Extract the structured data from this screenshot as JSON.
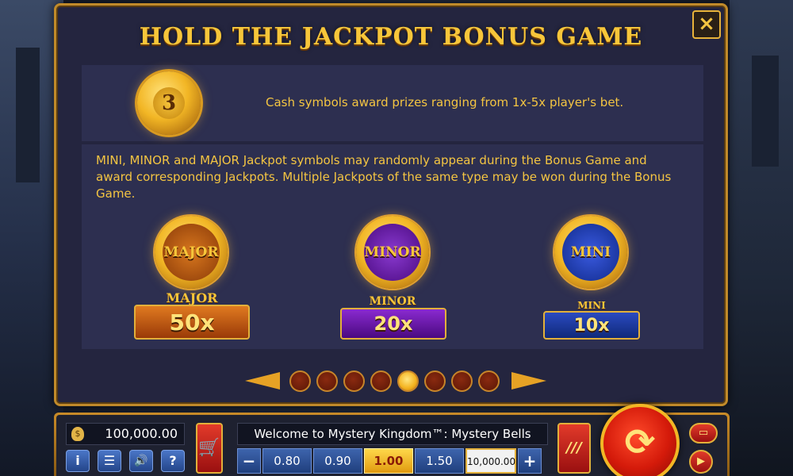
{
  "panel": {
    "title": "HOLD THE JACKPOT BONUS GAME",
    "close_icon": "×",
    "cash_coin_label": "3",
    "cash_text": "Cash symbols award prizes ranging from 1x-5x player's bet.",
    "jackpot_text": "MINI, MINOR and MAJOR Jackpot symbols may randomly appear during the Bonus Game and award corresponding Jackpots. Multiple Jackpots of the same type may be won during the Bonus Game.",
    "jackpots": [
      {
        "medal_label": "MAJOR",
        "name": "MAJOR",
        "multiplier": "50x",
        "color": "#c45a12"
      },
      {
        "medal_label": "MINOR",
        "name": "MINOR",
        "multiplier": "20x",
        "color": "#6a1fa0"
      },
      {
        "medal_label": "MINI",
        "name": "MINI",
        "multiplier": "10x",
        "color": "#1f3a9a"
      }
    ],
    "pagination": {
      "total": 8,
      "active_index": 4
    }
  },
  "bottom_bar": {
    "balance": "100,000.00",
    "money_icon": "$",
    "info_icon": "i",
    "menu_icon": "☰",
    "sound_icon": "🔊",
    "help_icon": "?",
    "cart_icon": "🛒",
    "welcome_text": "Welcome to Mystery Kingdom™: Mystery Bells",
    "minus_label": "−",
    "plus_label": "+",
    "bets": [
      "0.80",
      "0.90",
      "1.00",
      "1.50",
      "10,000.00"
    ],
    "selected_bet": "1.00",
    "autoplay_icon": "///",
    "spin_icon": "⟳",
    "top_small_icon": "▭",
    "play_icon": "▶"
  },
  "colors": {
    "gold": "#f4c542",
    "panel_bg": "#24253f",
    "panel_border": "#c08a2a"
  }
}
